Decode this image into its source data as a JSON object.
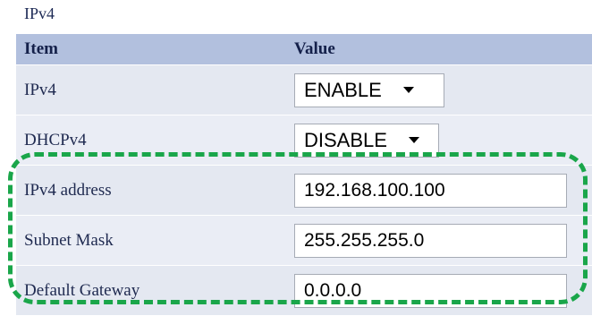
{
  "section": {
    "title": "IPv4"
  },
  "table": {
    "headers": {
      "item": "Item",
      "value": "Value"
    },
    "rows": [
      {
        "label": "IPv4",
        "type": "select",
        "value": "ENABLE"
      },
      {
        "label": "DHCPv4",
        "type": "select",
        "value": "DISABLE"
      },
      {
        "label": "IPv4 address",
        "type": "input",
        "value": "192.168.100.100"
      },
      {
        "label": "Subnet Mask",
        "type": "input",
        "value": "255.255.255.0"
      },
      {
        "label": "Default Gateway",
        "type": "input",
        "value": "0.0.0.0"
      }
    ]
  },
  "colors": {
    "header_bg": "#b2c0de",
    "row_bg": "#e8ecf4",
    "highlight_border": "#1aa64a",
    "text": "#1f2a50"
  },
  "icons": {
    "dropdown": "chevron-down-icon"
  }
}
